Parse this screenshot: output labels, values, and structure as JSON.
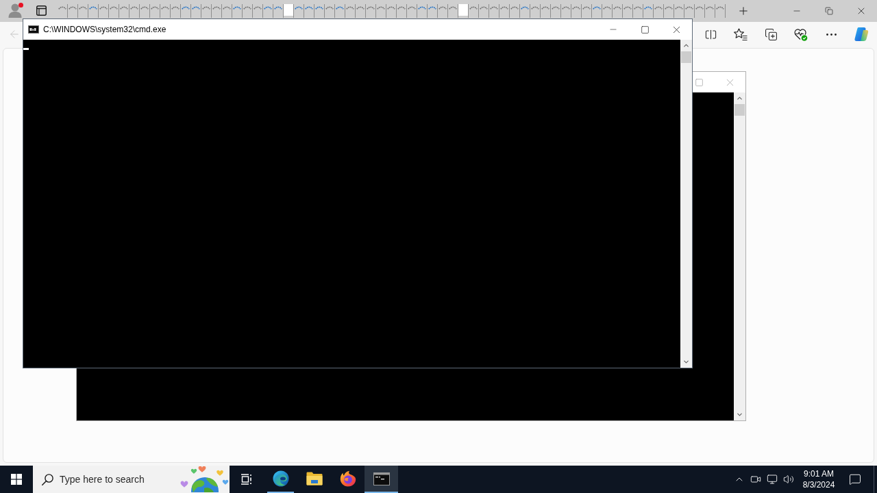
{
  "browser": {
    "profile": {
      "notification": true
    },
    "tabs": [
      {
        "kind": "idle"
      },
      {
        "kind": "idle"
      },
      {
        "kind": "idle"
      },
      {
        "kind": "loading"
      },
      {
        "kind": "idle"
      },
      {
        "kind": "idle"
      },
      {
        "kind": "idle"
      },
      {
        "kind": "idle"
      },
      {
        "kind": "idle"
      },
      {
        "kind": "idle"
      },
      {
        "kind": "idle"
      },
      {
        "kind": "idle"
      },
      {
        "kind": "loading"
      },
      {
        "kind": "loading"
      },
      {
        "kind": "idle"
      },
      {
        "kind": "idle"
      },
      {
        "kind": "idle"
      },
      {
        "kind": "loading"
      },
      {
        "kind": "idle"
      },
      {
        "kind": "idle"
      },
      {
        "kind": "loading"
      },
      {
        "kind": "loading"
      },
      {
        "kind": "blank"
      },
      {
        "kind": "loading"
      },
      {
        "kind": "loading"
      },
      {
        "kind": "loading"
      },
      {
        "kind": "idle"
      },
      {
        "kind": "loading"
      },
      {
        "kind": "idle"
      },
      {
        "kind": "idle"
      },
      {
        "kind": "idle"
      },
      {
        "kind": "idle"
      },
      {
        "kind": "idle"
      },
      {
        "kind": "idle"
      },
      {
        "kind": "idle"
      },
      {
        "kind": "loading"
      },
      {
        "kind": "loading"
      },
      {
        "kind": "idle"
      },
      {
        "kind": "idle"
      },
      {
        "kind": "blank"
      },
      {
        "kind": "idle"
      },
      {
        "kind": "idle"
      },
      {
        "kind": "idle"
      },
      {
        "kind": "idle"
      },
      {
        "kind": "idle"
      },
      {
        "kind": "loading"
      },
      {
        "kind": "idle"
      },
      {
        "kind": "idle"
      },
      {
        "kind": "idle"
      },
      {
        "kind": "idle"
      },
      {
        "kind": "idle"
      },
      {
        "kind": "idle"
      },
      {
        "kind": "loading"
      },
      {
        "kind": "idle"
      },
      {
        "kind": "idle"
      },
      {
        "kind": "idle"
      },
      {
        "kind": "idle"
      },
      {
        "kind": "loading"
      },
      {
        "kind": "idle"
      },
      {
        "kind": "idle"
      },
      {
        "kind": "idle"
      },
      {
        "kind": "idle"
      },
      {
        "kind": "idle"
      },
      {
        "kind": "idle"
      },
      {
        "kind": "idle"
      }
    ],
    "back_button": {
      "disabled": true
    }
  },
  "console_windows": [
    {
      "title": "C:\\WINDOWS\\system32\\cmd.exe",
      "focused": true,
      "cursor": true,
      "controls": [
        {
          "kind": "minimize"
        },
        {
          "kind": "maximize"
        },
        {
          "kind": "close"
        }
      ]
    },
    {
      "focused": false,
      "controls": [
        {
          "kind": "maximize"
        },
        {
          "kind": "close"
        }
      ]
    }
  ],
  "taskbar": {
    "search": {
      "placeholder": "Type here to search"
    },
    "apps": [
      {
        "kind": "edge",
        "running": true,
        "selected": false
      },
      {
        "kind": "explorer",
        "running": false,
        "selected": false
      },
      {
        "kind": "firefox",
        "running": false,
        "selected": false
      },
      {
        "kind": "terminal",
        "running": true,
        "selected": true
      }
    ],
    "clock": {
      "time": "9:01 AM",
      "date": "8/3/2024"
    }
  }
}
